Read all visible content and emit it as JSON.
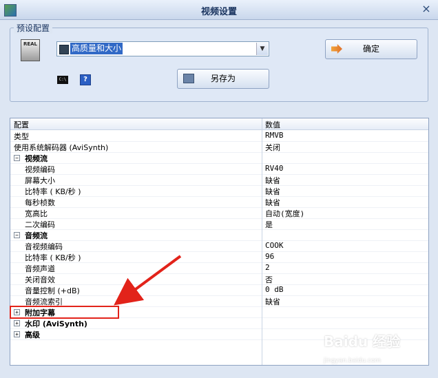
{
  "window": {
    "title": "视频设置",
    "close_glyph": "×"
  },
  "preset": {
    "group_label": "预设配置",
    "real_icon_text": "REAL",
    "selected": "高质量和大小",
    "ok_label": "确定",
    "saveas_label": "另存为",
    "cmd_icon_text": "C:\\",
    "help_glyph": "?"
  },
  "grid": {
    "header": {
      "col1": "配置",
      "col2": "数值"
    },
    "rows": [
      {
        "label": "类型",
        "value": "RMVB"
      },
      {
        "label": "使用系统解码器 (AviSynth)",
        "value": "关闭"
      },
      {
        "label": "视频流",
        "section": true,
        "expanded": true
      },
      {
        "label": "视频编码",
        "value": "RV40"
      },
      {
        "label": "屏幕大小",
        "value": "缺省"
      },
      {
        "label": "比特率 ( KB/秒 )",
        "value": "缺省"
      },
      {
        "label": "每秒桢数",
        "value": "缺省"
      },
      {
        "label": "宽高比",
        "value": "自动(宽度)"
      },
      {
        "label": "二次编码",
        "value": "是"
      },
      {
        "label": "音频流",
        "section": true,
        "expanded": true
      },
      {
        "label": "音视频编码",
        "value": "COOK"
      },
      {
        "label": "比特率 ( KB/秒 )",
        "value": "96"
      },
      {
        "label": "音频声道",
        "value": "2"
      },
      {
        "label": "关闭音效",
        "value": "否"
      },
      {
        "label": "音量控制 (+dB)",
        "value": "0 dB"
      },
      {
        "label": "音频流索引",
        "value": "缺省"
      },
      {
        "label": "附加字幕",
        "section": true,
        "expanded": false
      },
      {
        "label": "水印 (AviSynth)",
        "section": true,
        "expanded": false
      },
      {
        "label": "高级",
        "section": true,
        "expanded": false
      }
    ]
  },
  "watermark": {
    "text": "Baidu 经验",
    "sub": "jingyan.baidu.com"
  },
  "colors": {
    "highlight": "#e2231a",
    "selection": "#3169c6"
  }
}
